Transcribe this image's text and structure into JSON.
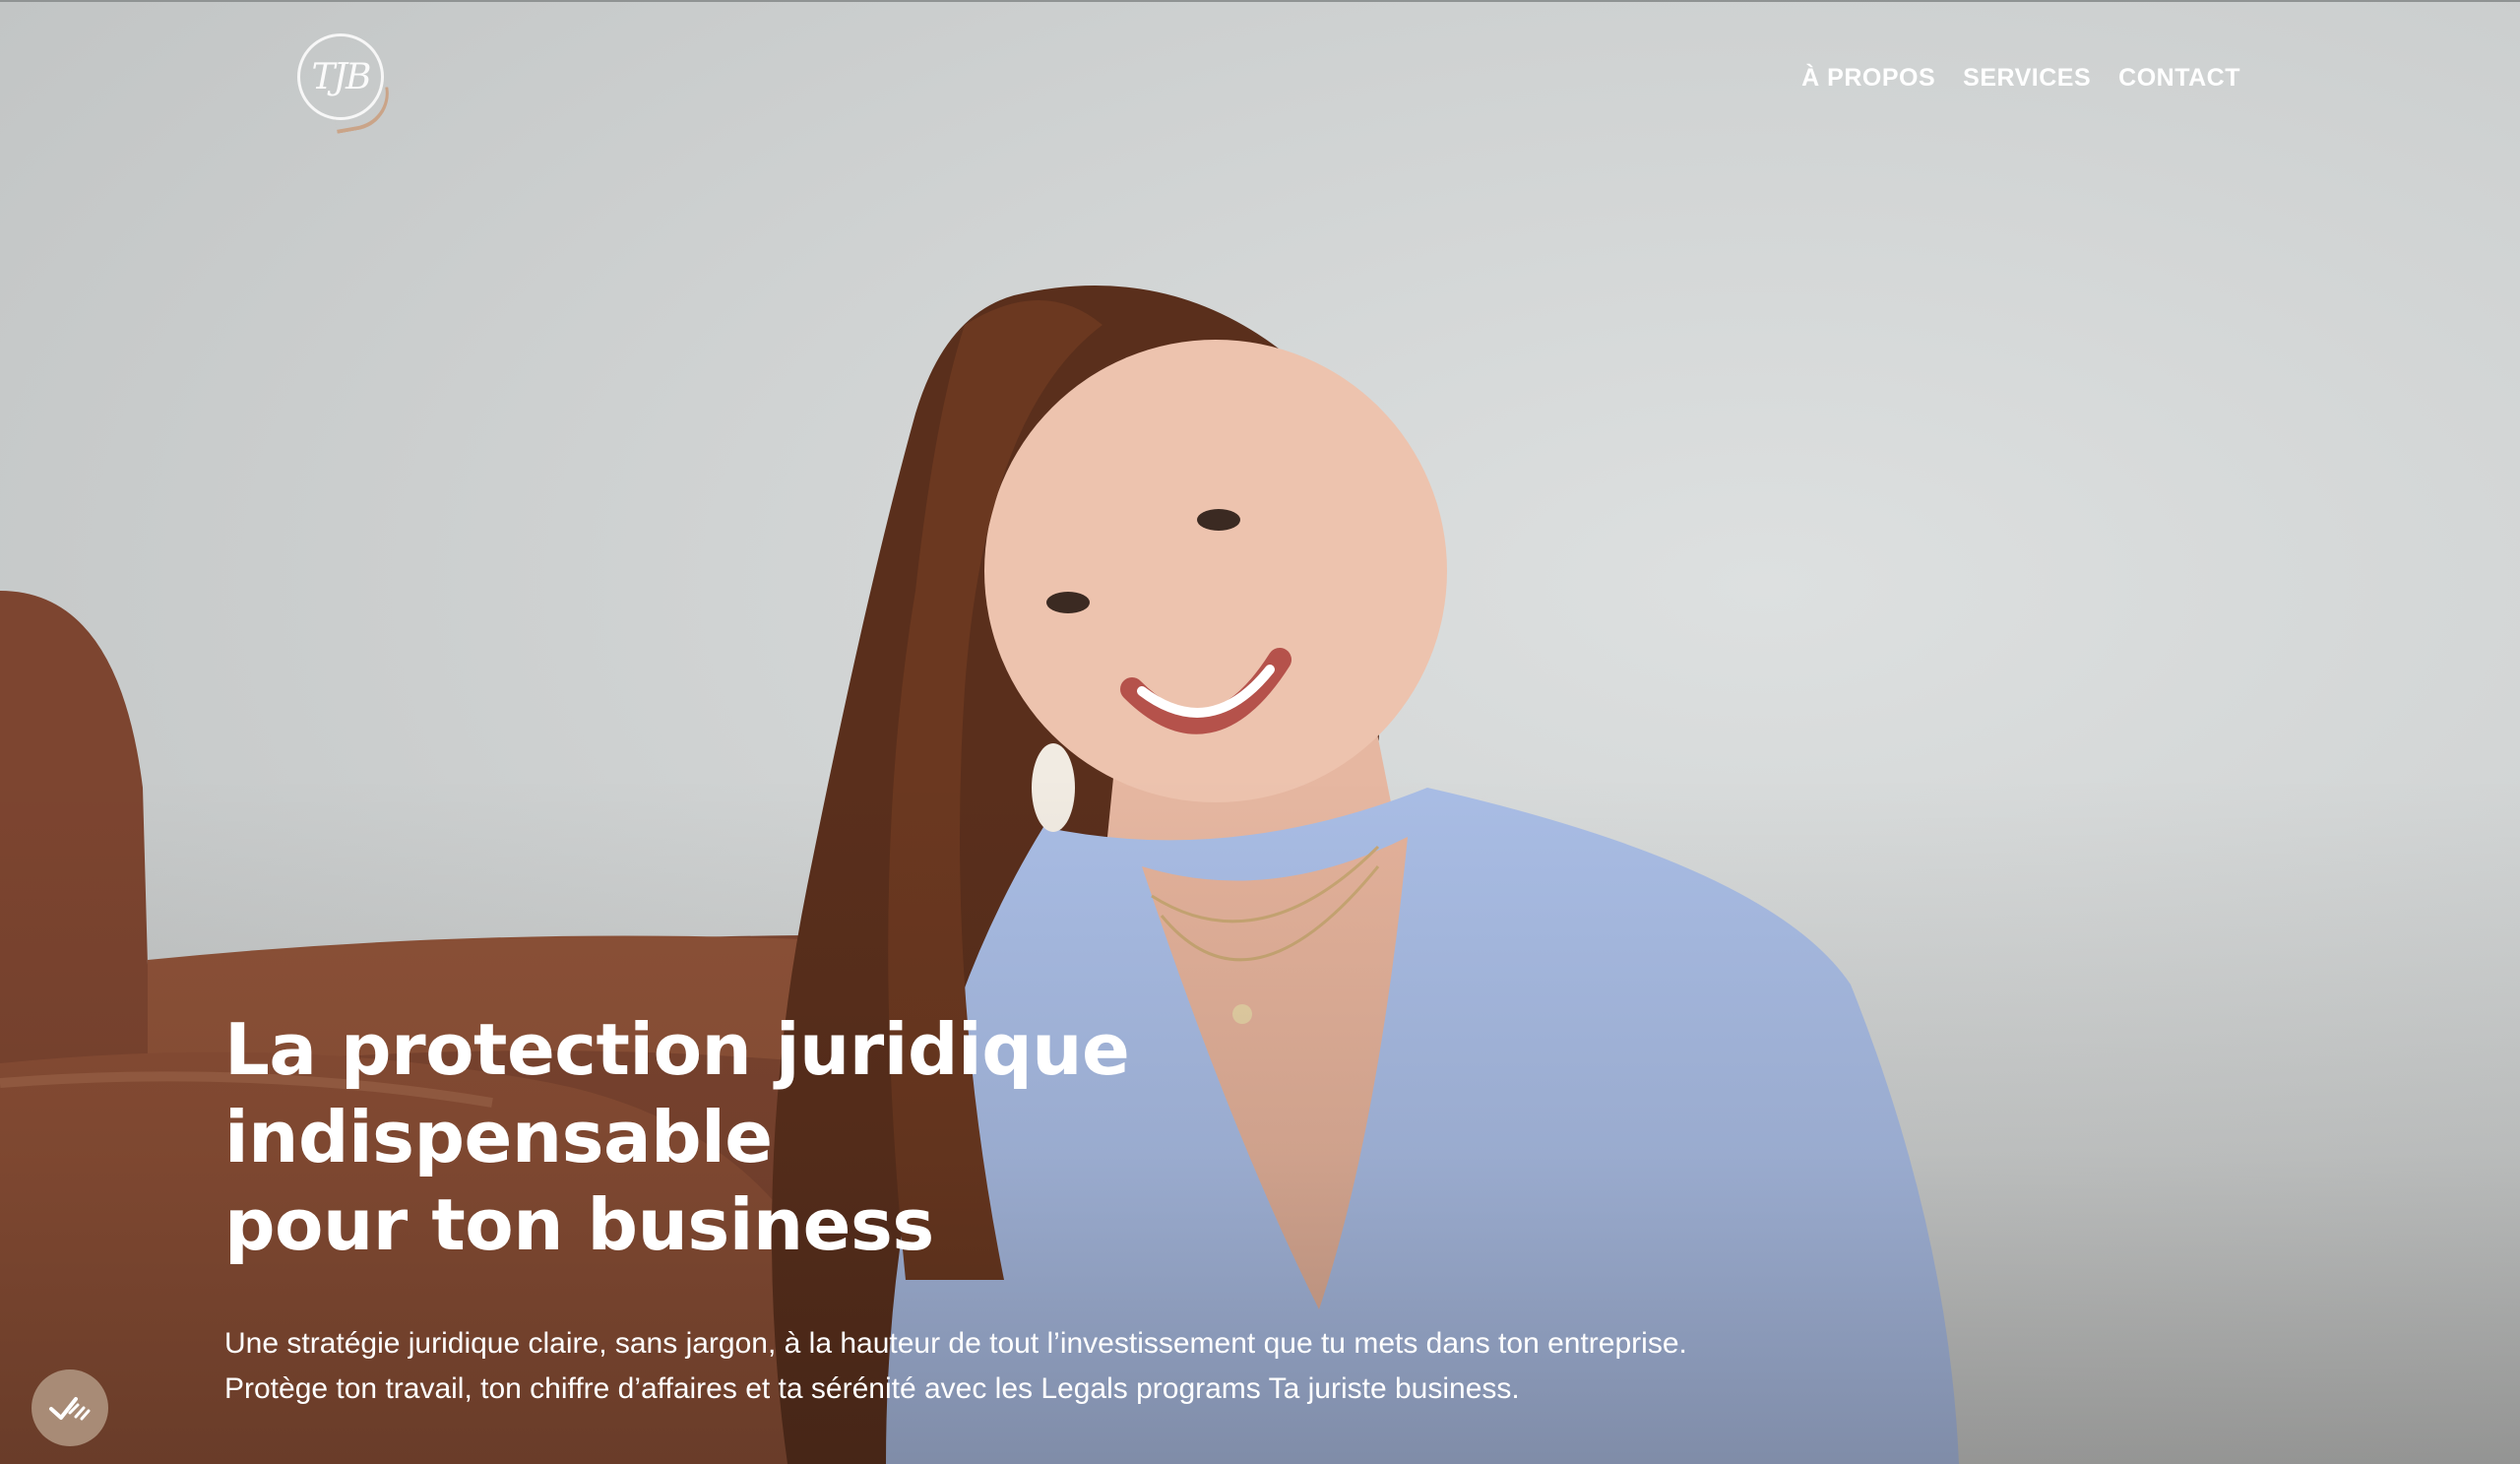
{
  "header": {
    "logo_text": "TJB",
    "nav": [
      {
        "label": "À PROPOS"
      },
      {
        "label": "SERVICES"
      },
      {
        "label": "CONTACT"
      }
    ]
  },
  "hero": {
    "title_lines": [
      "La protection juridique",
      "indispensable",
      "pour ton business"
    ],
    "subtitle_lines": [
      "Une stratégie juridique claire, sans jargon, à la hauteur de tout l’investissement que tu mets dans ton entreprise.",
      "Protège ton travail, ton chiffre d’affaires et ta sérénité avec les Legals programs Ta juriste business."
    ]
  },
  "consent_button": {
    "icon": "double-check-icon"
  },
  "colors": {
    "nav_text": "#ffffff",
    "hero_text": "#ffffff",
    "consent_button_bg": "#a88b76",
    "background": "#cfd2d2"
  }
}
